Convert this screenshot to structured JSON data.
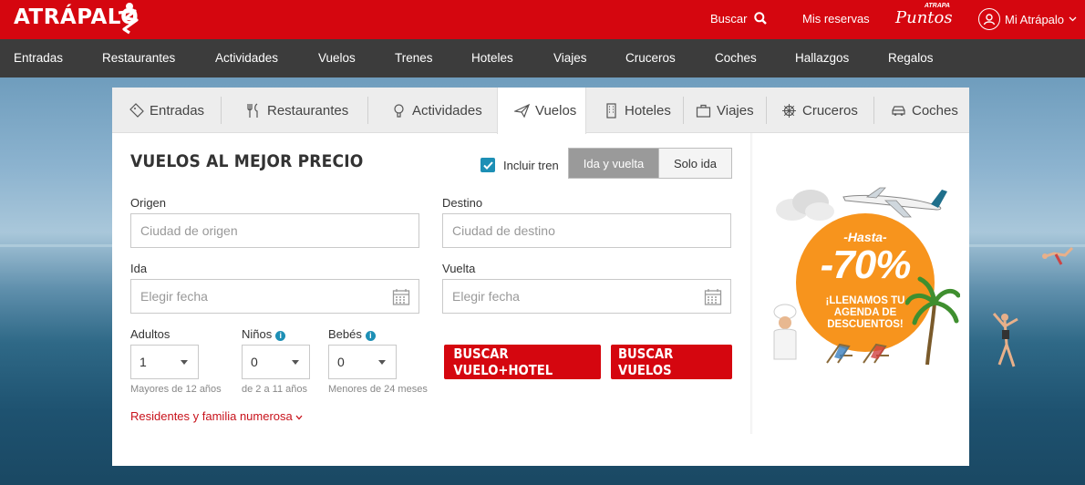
{
  "brand": {
    "name": "ATRÁPALO",
    "red": "#d5060f",
    "accent_blue": "#1d8fb5",
    "promo_orange": "#f7941d"
  },
  "topbar": {
    "search_label": "Buscar",
    "reservas_label": "Mis reservas",
    "puntos_small": "ATRAPA",
    "puntos_big": "Puntos",
    "account_label": "Mi Atrápalo"
  },
  "categories": [
    "Entradas",
    "Restaurantes",
    "Actividades",
    "Vuelos",
    "Trenes",
    "Hoteles",
    "Viajes",
    "Cruceros",
    "Coches",
    "Hallazgos",
    "Regalos"
  ],
  "tabs": [
    {
      "label": "Entradas",
      "icon": "ticket-icon"
    },
    {
      "label": "Restaurantes",
      "icon": "cutlery-icon"
    },
    {
      "label": "Actividades",
      "icon": "lightbulb-icon"
    },
    {
      "label": "Vuelos",
      "icon": "plane-icon",
      "active": true
    },
    {
      "label": "Hoteles",
      "icon": "building-icon"
    },
    {
      "label": "Viajes",
      "icon": "suitcase-icon"
    },
    {
      "label": "Cruceros",
      "icon": "wheel-icon"
    },
    {
      "label": "Coches",
      "icon": "car-icon"
    }
  ],
  "form": {
    "title": "VUELOS AL MEJOR PRECIO",
    "incluir_tren_label": "Incluir tren",
    "incluir_tren_checked": true,
    "trip_type": {
      "roundtrip": "Ida y vuelta",
      "oneway": "Solo ida",
      "selected": "Ida y vuelta"
    },
    "origen_label": "Origen",
    "origen_placeholder": "Ciudad de origen",
    "destino_label": "Destino",
    "destino_placeholder": "Ciudad de destino",
    "ida_label": "Ida",
    "ida_placeholder": "Elegir fecha",
    "vuelta_label": "Vuelta",
    "vuelta_placeholder": "Elegir fecha",
    "adultos_label": "Adultos",
    "adultos_value": "1",
    "adultos_hint": "Mayores de 12 años",
    "ninos_label": "Niños",
    "ninos_value": "0",
    "ninos_hint": "de 2 a 11 años",
    "bebes_label": "Bebés",
    "bebes_value": "0",
    "bebes_hint": "Menores de 24 meses",
    "btn_vuelo_hotel": "BUSCAR VUELO+HOTEL",
    "btn_vuelos": "BUSCAR VUELOS",
    "residentes_link": "Residentes y familia numerosa"
  },
  "promo": {
    "hasta": "-Hasta-",
    "discount": "-70%",
    "text": "¡LLENAMOS TU AGENDA DE DESCUENTOS!"
  }
}
